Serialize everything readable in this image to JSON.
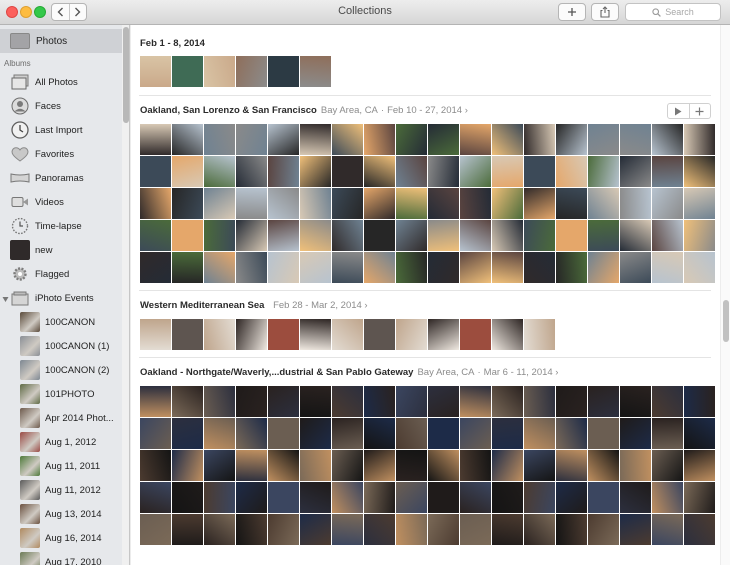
{
  "window": {
    "title": "Collections",
    "search_placeholder": "Search"
  },
  "sidebar": {
    "top_item": "Photos",
    "albums_heading": "Albums",
    "albums": [
      {
        "label": "All Photos",
        "icon": "all-photos-icon"
      },
      {
        "label": "Faces",
        "icon": "faces-icon"
      },
      {
        "label": "Last Import",
        "icon": "clock-icon"
      },
      {
        "label": "Favorites",
        "icon": "heart-icon"
      },
      {
        "label": "Panoramas",
        "icon": "panorama-icon"
      },
      {
        "label": "Videos",
        "icon": "video-icon"
      },
      {
        "label": "Time-lapse",
        "icon": "timelapse-icon"
      },
      {
        "label": "new",
        "icon": "album-thumbnail"
      },
      {
        "label": "Flagged",
        "icon": "gear-flag-icon"
      },
      {
        "label": "iPhoto Events",
        "icon": "folder-icon"
      }
    ],
    "events": [
      {
        "label": "100CANON",
        "color": "#5a4a3a"
      },
      {
        "label": "100CANON (1)",
        "color": "#8a8f96"
      },
      {
        "label": "100CANON (2)",
        "color": "#7d8792"
      },
      {
        "label": "101PHOTO",
        "color": "#5f6b45"
      },
      {
        "label": "Apr 2014 Phot...",
        "color": "#6e5a4c"
      },
      {
        "label": "Aug 1, 2012",
        "color": "#9a4a44"
      },
      {
        "label": "Aug 11, 2011",
        "color": "#4e7a3a"
      },
      {
        "label": "Aug 11, 2012",
        "color": "#5a5a5a"
      },
      {
        "label": "Aug 13, 2014",
        "color": "#6b5140"
      },
      {
        "label": "Aug 16, 2014",
        "color": "#b08a60"
      },
      {
        "label": "Aug 17, 2010",
        "color": "#6b7a55"
      }
    ]
  },
  "collections": [
    {
      "title": "Feb 1 - 8, 2014",
      "location": "",
      "date": "",
      "rows": 1,
      "cols": 6,
      "palette": [
        "#caa98a",
        "#3f6b55",
        "#d9c4a5",
        "#8e6e5a",
        "#2c3a44",
        "#8c8c8c"
      ]
    },
    {
      "title": "Oakland, San Lorenzo & San Francisco",
      "location": "Bay Area, CA",
      "date": "Feb 10 - 27, 2014 ›",
      "rows": 5,
      "cols": 18,
      "palette": [
        "#8a8a8a",
        "#5a4440",
        "#d8c9b5",
        "#302a2a",
        "#e5a76a",
        "#6f8292",
        "#242b36",
        "#b7c3cf",
        "#f0c07a",
        "#3c4a58",
        "#262626",
        "#4b6b3a"
      ]
    },
    {
      "title": "Western Mediterranean Sea",
      "location": "",
      "date": "Feb 28 - Mar 2, 2014 ›",
      "rows": 1,
      "cols": 13,
      "palette": [
        "#e3dcd3",
        "#5e5550",
        "#bfa58c",
        "#2e2624",
        "#9c4d3e",
        "#f0e9e1"
      ]
    },
    {
      "title": "Oakland - Northgate/Waverly,...dustrial & San Pablo Gateway",
      "location": "Bay Area, CA",
      "date": "Mar 6 - 11, 2014 ›",
      "rows": 5,
      "cols": 18,
      "palette": [
        "#1f1b1a",
        "#4c3b30",
        "#2c2f3e",
        "#6b5e52",
        "#141414",
        "#3b4660",
        "#7b6a58",
        "#2a2220",
        "#1d2b48",
        "#c09060"
      ]
    }
  ]
}
